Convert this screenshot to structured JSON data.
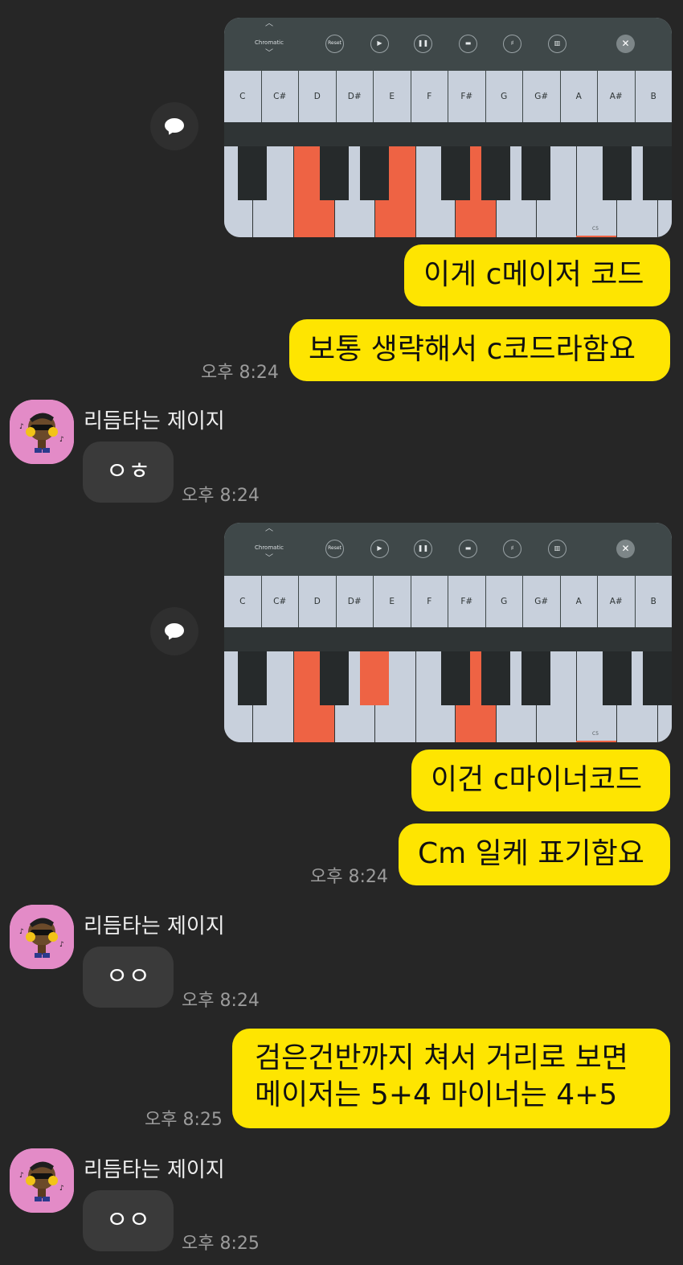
{
  "piano_app": {
    "mode_label": "Chromatic",
    "reset_label": "Reset",
    "note_labels": [
      "C",
      "C#",
      "D",
      "D#",
      "E",
      "F",
      "F#",
      "G",
      "G#",
      "A",
      "A#",
      "B"
    ],
    "octave_label": "C5",
    "toolbar_icons": [
      "chevron-up-icon",
      "chevron-down-icon",
      "play-icon",
      "pause-icon",
      "menu-icon",
      "sharp-icon",
      "chord-icon",
      "close-icon"
    ]
  },
  "colors": {
    "background": "#262626",
    "my_bubble": "#fee501",
    "their_bubble": "#3a3a3a",
    "highlight_key": "#ee6344",
    "avatar_bg": "#e38bc7"
  },
  "messages": {
    "m1_img_chord": "C major",
    "m2": "이게 c메이저 코드",
    "m3": "보통 생략해서 c코드라함요",
    "t1": "오후 8:24",
    "sender_name": "리듬타는 제이지",
    "r1": "ㅇㅎ",
    "t2": "오후 8:24",
    "m5": "이건 c마이너코드",
    "m6": "Cm 일케 표기함요",
    "t3": "오후 8:24",
    "r2": "ㅇㅇ",
    "t4": "오후 8:24",
    "m7_line1": "검은건반까지 쳐서 거리로 보면",
    "m7_line2": "메이저는 5+4 마이너는 4+5",
    "t5": "오후 8:25",
    "r3": "ㅇㅇ",
    "t6": "오후 8:25"
  }
}
